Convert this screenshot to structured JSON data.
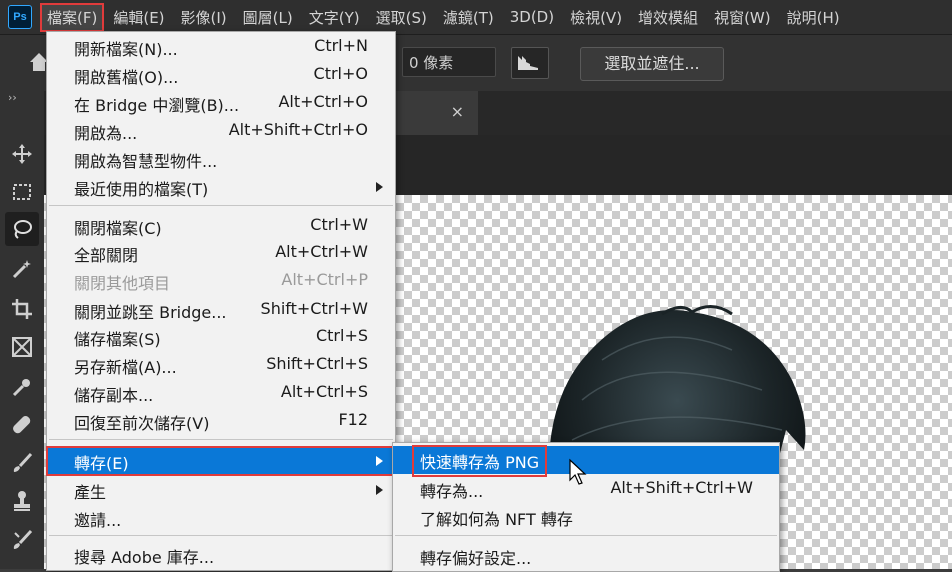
{
  "app": {
    "logo": "Ps"
  },
  "menubar": [
    "檔案(F)",
    "編輯(E)",
    "影像(I)",
    "圖層(L)",
    "文字(Y)",
    "選取(S)",
    "濾鏡(T)",
    "3D(D)",
    "檢視(V)",
    "增效模組",
    "視窗(W)",
    "說明(H)"
  ],
  "optbar": {
    "feather_value": "0 像素",
    "select_mask_label": "選取並遮住..."
  },
  "toolbar": {
    "collapse": "››",
    "tools": [
      "move-icon",
      "marquee-icon",
      "lasso-icon",
      "magic-wand-icon",
      "crop-icon",
      "frame-icon",
      "eyedropper-icon",
      "healing-icon",
      "brush-icon",
      "stamp-icon",
      "history-brush-icon"
    ]
  },
  "tab": {
    "close": "×"
  },
  "file_menu": {
    "items": [
      {
        "label": "開新檔案(N)...",
        "shortcut": "Ctrl+N"
      },
      {
        "label": "開啟舊檔(O)...",
        "shortcut": "Ctrl+O"
      },
      {
        "label": "在 Bridge 中瀏覽(B)...",
        "shortcut": "Alt+Ctrl+O"
      },
      {
        "label": "開啟為...",
        "shortcut": "Alt+Shift+Ctrl+O"
      },
      {
        "label": "開啟為智慧型物件...",
        "shortcut": ""
      },
      {
        "label": "最近使用的檔案(T)",
        "shortcut": ""
      },
      {
        "label": "關閉檔案(C)",
        "shortcut": "Ctrl+W"
      },
      {
        "label": "全部關閉",
        "shortcut": "Alt+Ctrl+W"
      },
      {
        "label": "關閉其他項目",
        "shortcut": "Alt+Ctrl+P"
      },
      {
        "label": "關閉並跳至 Bridge...",
        "shortcut": "Shift+Ctrl+W"
      },
      {
        "label": "儲存檔案(S)",
        "shortcut": "Ctrl+S"
      },
      {
        "label": "另存新檔(A)...",
        "shortcut": "Shift+Ctrl+S"
      },
      {
        "label": "儲存副本...",
        "shortcut": "Alt+Ctrl+S"
      },
      {
        "label": "回復至前次儲存(V)",
        "shortcut": "F12"
      },
      {
        "label": "轉存(E)",
        "shortcut": ""
      },
      {
        "label": "產生",
        "shortcut": ""
      },
      {
        "label": "邀請...",
        "shortcut": ""
      },
      {
        "label": "搜尋 Adobe 庫存...",
        "shortcut": ""
      }
    ]
  },
  "export_submenu": {
    "items": [
      {
        "label": "快速轉存為 PNG",
        "shortcut": ""
      },
      {
        "label": "轉存為...",
        "shortcut": "Alt+Shift+Ctrl+W"
      },
      {
        "label": "了解如何為 NFT 轉存",
        "shortcut": ""
      },
      {
        "label": "轉存偏好設定...",
        "shortcut": ""
      }
    ]
  }
}
